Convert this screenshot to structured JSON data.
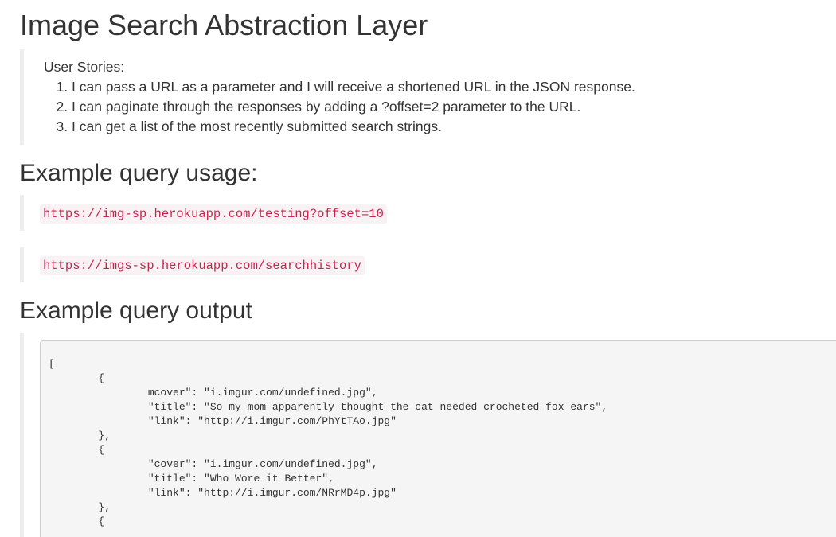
{
  "page": {
    "title": "Image Search Abstraction Layer"
  },
  "stories": {
    "heading": "User Stories:",
    "items": [
      "I can pass a URL as a parameter and I will receive a shortened URL in the JSON response.",
      "I can paginate through the responses by adding a ?offset=2 parameter to the URL.",
      "I can get a list of the most recently submitted search strings."
    ]
  },
  "usage": {
    "heading": "Example query usage:",
    "urls": [
      "https://img-sp.herokuapp.com/testing?offset=10",
      "https://imgs-sp.herokuapp.com/searchhistory"
    ]
  },
  "output": {
    "heading": "Example query output",
    "lines": [
      "[",
      "\t{",
      "\t\tmcover\": \"i.imgur.com/undefined.jpg\",",
      "\t\t\"title\": \"So my mom apparently thought the cat needed crocheted fox ears\",",
      "\t\t\"link\": \"http://i.imgur.com/PhYtTAo.jpg\"",
      "\t},",
      "\t{",
      "\t\t\"cover\": \"i.imgur.com/undefined.jpg\",",
      "\t\t\"title\": \"Who Wore it Better\",",
      "\t\t\"link\": \"http://i.imgur.com/NRrMD4p.jpg\"",
      "\t},",
      "\t{"
    ]
  },
  "colors": {
    "code_text": "#c7254e",
    "code_bg": "#f9f2f4",
    "blockquote_border": "#eeeeee",
    "pre_bg": "#f5f5f5"
  }
}
